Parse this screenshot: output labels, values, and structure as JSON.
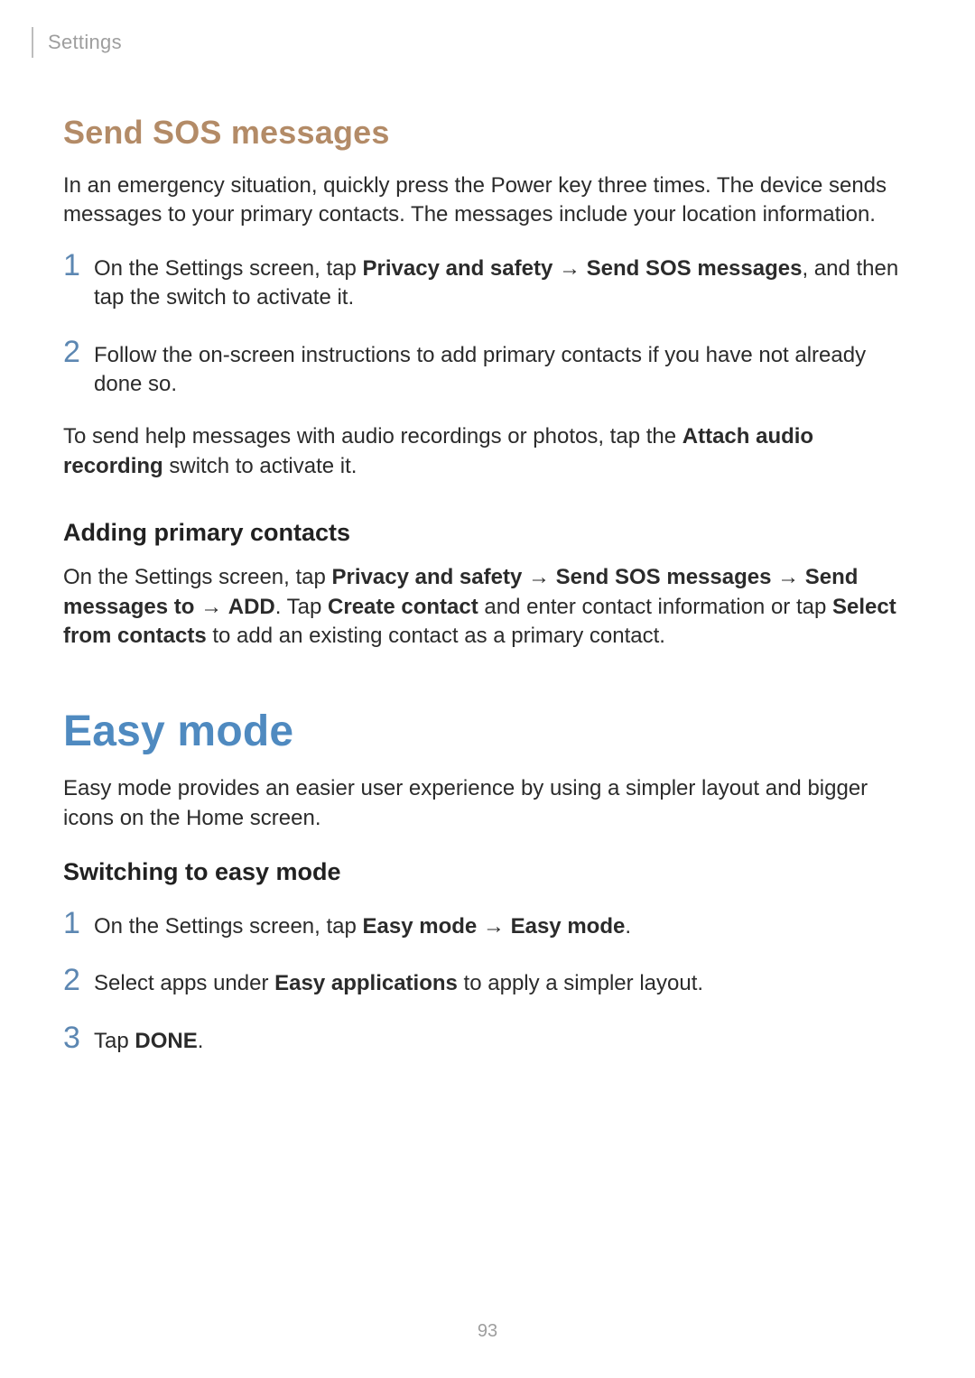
{
  "header": {
    "section": "Settings"
  },
  "sos": {
    "title": "Send SOS messages",
    "intro": "In an emergency situation, quickly press the Power key three times. The device sends messages to your primary contacts. The messages include your location information.",
    "steps": [
      {
        "num": "1",
        "pre": "On the Settings screen, tap ",
        "b1": "Privacy and safety",
        "mid": " → ",
        "b2": "Send SOS messages",
        "post": ", and then tap the switch to activate it."
      },
      {
        "num": "2",
        "text": "Follow the on-screen instructions to add primary contacts if you have not already done so."
      }
    ],
    "audio_pre": "To send help messages with audio recordings or photos, tap the ",
    "audio_bold": "Attach audio recording",
    "audio_post": " switch to activate it.",
    "subheading": "Adding primary contacts",
    "addp_pre": "On the Settings screen, tap ",
    "addp_b1": "Privacy and safety",
    "addp_a1": " → ",
    "addp_b2": "Send SOS messages",
    "addp_a2": " → ",
    "addp_b3": "Send messages to",
    "addp_a3": " → ",
    "addp_b4": "ADD",
    "addp_mid": ". Tap ",
    "addp_b5": "Create contact",
    "addp_mid2": " and enter contact information or tap ",
    "addp_b6": "Select from contacts",
    "addp_post": " to add an existing contact as a primary contact."
  },
  "easy": {
    "title": "Easy mode",
    "intro": "Easy mode provides an easier user experience by using a simpler layout and bigger icons on the Home screen.",
    "subheading": "Switching to easy mode",
    "steps": [
      {
        "num": "1",
        "pre": "On the Settings screen, tap ",
        "b1": "Easy mode",
        "mid": " → ",
        "b2": "Easy mode",
        "post": "."
      },
      {
        "num": "2",
        "pre": "Select apps under ",
        "b1": "Easy applications",
        "post": " to apply a simpler layout."
      },
      {
        "num": "3",
        "pre": "Tap ",
        "b1": "DONE",
        "post": "."
      }
    ]
  },
  "page_number": "93"
}
